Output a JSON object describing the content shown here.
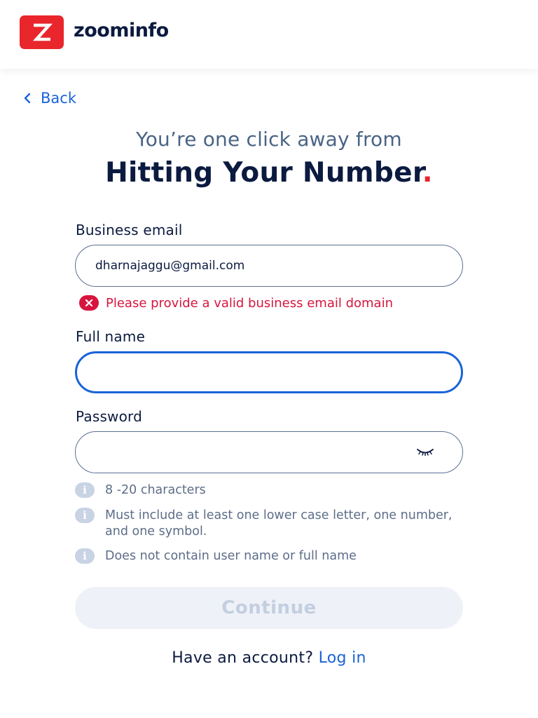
{
  "header": {
    "logo_text": "zoominfo",
    "logo_icon": "zoominfo-z-logo-icon",
    "brand_color": "#e8262b"
  },
  "nav": {
    "back_label": "Back",
    "back_icon": "chevron-left-icon"
  },
  "hero": {
    "subtitle": "You’re one click away from",
    "headline": "Hitting Your Number",
    "headline_dot": "."
  },
  "form": {
    "email": {
      "label": "Business email",
      "value": "dharnajaggu@gmail.com",
      "error": "Please provide a valid business email domain"
    },
    "full_name": {
      "label": "Full name",
      "value": ""
    },
    "password": {
      "label": "Password",
      "value": "",
      "toggle_icon": "eye-closed-icon"
    },
    "rules": [
      "8 -20 characters",
      "Must include at least one lower case letter, one number, and one symbol.",
      "Does not contain user name or full name"
    ],
    "continue_label": "Continue"
  },
  "footer": {
    "prompt": "Have an account?",
    "login_label": "Log in"
  },
  "colors": {
    "accent": "#1a63d8",
    "error": "#d6163e",
    "text_dark": "#0b1a3f",
    "disabled_button_bg": "#eef2f8"
  }
}
